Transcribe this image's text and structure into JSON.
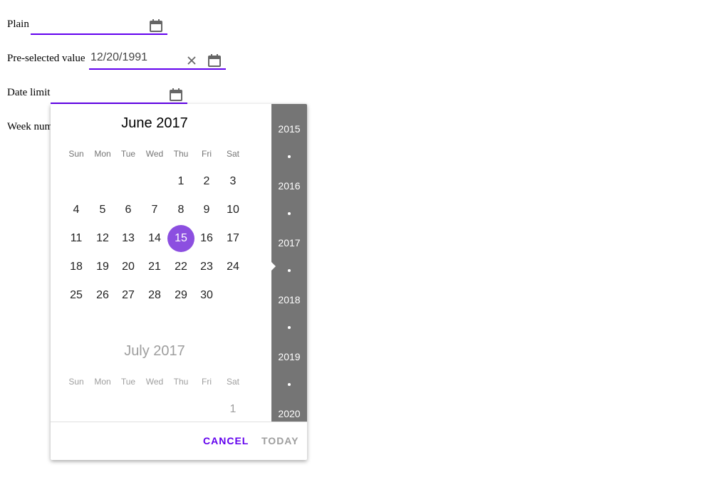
{
  "fields": {
    "plain": {
      "label": "Plain",
      "value": ""
    },
    "preselected": {
      "label": "Pre-selected value",
      "value": "12/20/1991"
    },
    "date_limit": {
      "label": "Date limit",
      "value": ""
    },
    "week_num": {
      "label": "Week num"
    }
  },
  "picker": {
    "months": [
      {
        "title": "June 2017",
        "weekdays": [
          "Sun",
          "Mon",
          "Tue",
          "Wed",
          "Thu",
          "Fri",
          "Sat"
        ],
        "first_weekday": 4,
        "days": 30,
        "selected": 15
      },
      {
        "title": "July 2017",
        "weekdays": [
          "Sun",
          "Mon",
          "Tue",
          "Wed",
          "Thu",
          "Fri",
          "Sat"
        ],
        "first_weekday": 6,
        "visible_days": [
          "1"
        ]
      }
    ],
    "years": [
      "2015",
      "2016",
      "2017",
      "2018",
      "2019",
      "2020"
    ],
    "current_year": "2017",
    "buttons": {
      "cancel": "CANCEL",
      "today": "TODAY"
    }
  },
  "colors": {
    "accent": "#6200ee",
    "selected_day": "#8c4fe0",
    "year_strip": "#757575",
    "disabled_text": "#9e9e9e"
  },
  "icons": {
    "calendar": "calendar-icon",
    "clear": "close-icon"
  }
}
